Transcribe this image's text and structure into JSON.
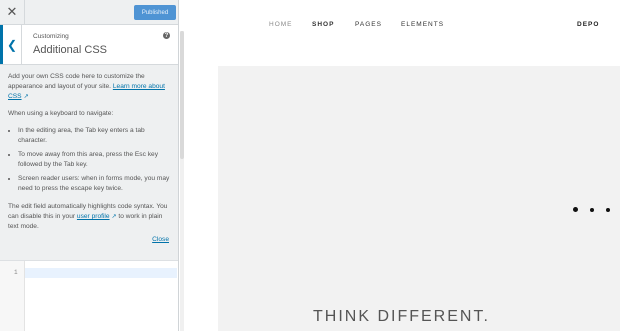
{
  "topbar": {
    "close_glyph": "✕",
    "published_label": "Published"
  },
  "section": {
    "breadcrumb": "Customizing",
    "title": "Additional CSS",
    "back_glyph": "❮",
    "help_glyph": "?"
  },
  "content": {
    "intro_text": "Add your own CSS code here to customize the appearance and layout of your site.",
    "learn_more_link": "Learn more about CSS",
    "keyboard_heading": "When using a keyboard to navigate:",
    "bullets": [
      "In the editing area, the Tab key enters a tab character.",
      "To move away from this area, press the Esc key followed by the Tab key.",
      "Screen reader users: when in forms mode, you may need to press the escape key twice."
    ],
    "highlight_text_before": "The edit field automatically highlights code syntax. You can disable this in your",
    "user_profile_link": "user profile",
    "highlight_text_after": "to work in plain text mode.",
    "close_link": "Close",
    "external_icon": "external-link-icon"
  },
  "editor": {
    "line_number": "1"
  },
  "preview": {
    "nav": {
      "home": "HOME",
      "shop": "SHOP",
      "pages": "PAGES",
      "elements": "ELEMENTS"
    },
    "logo": "DEPO",
    "tagline": "THINK DIFFERENT."
  },
  "colors": {
    "accent": "#0073aa",
    "button": "#4f94d4",
    "sidebar_bg": "#eef0f1",
    "hero_bg": "#f2f2f2"
  }
}
